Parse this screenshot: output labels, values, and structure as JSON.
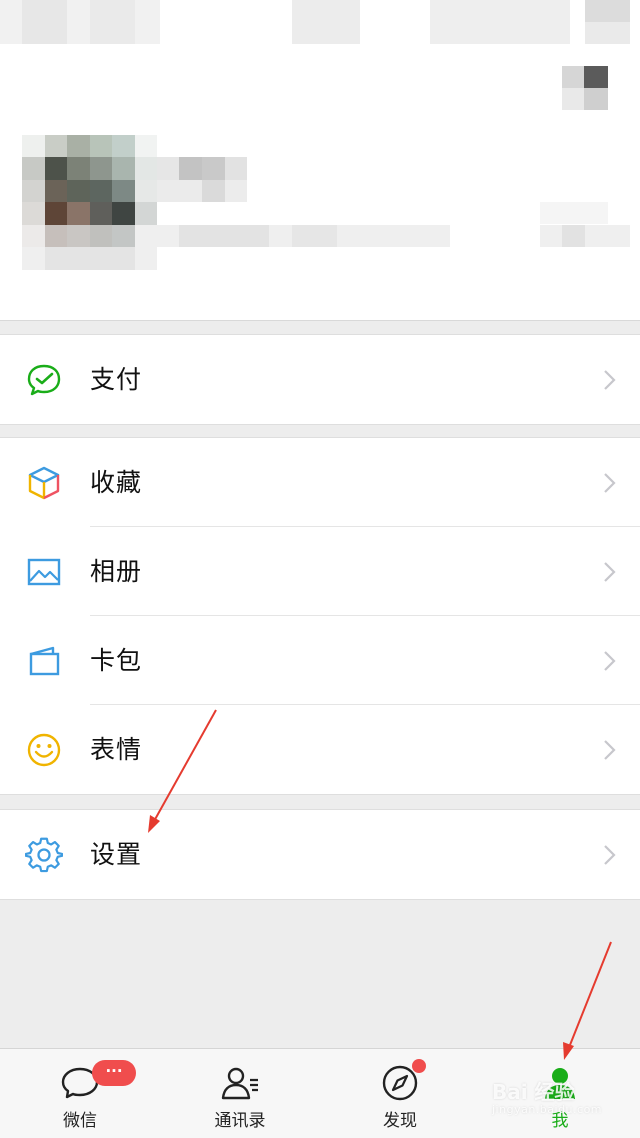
{
  "menu": {
    "pay": {
      "label": "支付",
      "icon": "pay-icon"
    },
    "favorites": {
      "label": "收藏",
      "icon": "favorites-icon"
    },
    "album": {
      "label": "相册",
      "icon": "album-icon"
    },
    "cards": {
      "label": "卡包",
      "icon": "card-wallet-icon"
    },
    "stickers": {
      "label": "表情",
      "icon": "sticker-icon"
    },
    "settings": {
      "label": "设置",
      "icon": "gear-icon"
    }
  },
  "tabbar": {
    "chats": {
      "label": "微信",
      "badge": "···",
      "icon": "chat-bubble-icon"
    },
    "contacts": {
      "label": "通讯录",
      "icon": "contacts-icon"
    },
    "discover": {
      "label": "发现",
      "icon": "compass-icon"
    },
    "me": {
      "label": "我",
      "icon": "person-icon",
      "active": true
    }
  },
  "colors": {
    "accent_green": "#1aad19",
    "badge_red": "#f04d4d",
    "annotation_red": "#e53b2f"
  },
  "watermark": {
    "brand": "Bai 经验",
    "url": "jingyan.baidu.com"
  }
}
